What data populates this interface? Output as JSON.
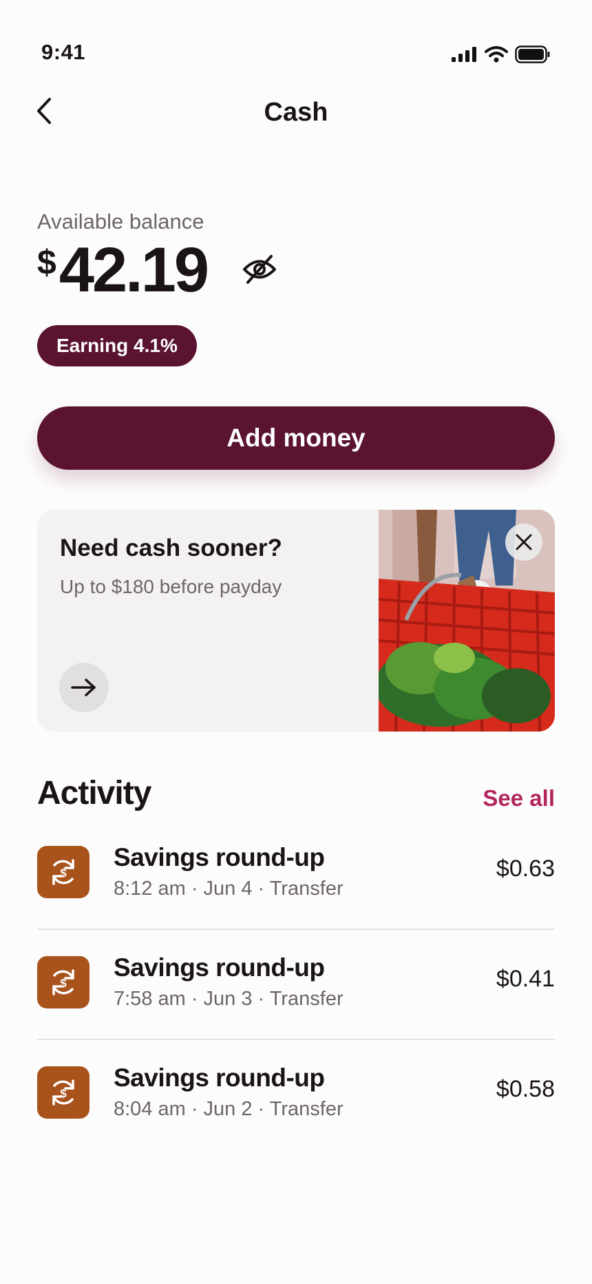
{
  "status": {
    "time": "9:41"
  },
  "nav": {
    "title": "Cash"
  },
  "balance": {
    "label": "Available balance",
    "currency": "$",
    "amount": "42.19"
  },
  "earning_badge": "Earning 4.1%",
  "add_money_label": "Add money",
  "promo": {
    "title": "Need cash sooner?",
    "subtitle": "Up to $180 before payday"
  },
  "activity": {
    "title": "Activity",
    "see_all": "See all",
    "items": [
      {
        "name": "Savings round-up",
        "meta": "8:12 am · Jun 4 · Transfer",
        "amount": "$0.63"
      },
      {
        "name": "Savings round-up",
        "meta": "7:58 am · Jun 3 · Transfer",
        "amount": "$0.41"
      },
      {
        "name": "Savings round-up",
        "meta": "8:04 am · Jun 2 · Transfer",
        "amount": "$0.58"
      }
    ]
  },
  "colors": {
    "brand": "#5a1330",
    "accent_link": "#b2255d",
    "txn_icon": "#a8521c"
  },
  "icons": [
    "back-chevron-icon",
    "eye-slash-icon",
    "arrow-right-icon",
    "close-icon",
    "round-up-dollar-icon",
    "cellular-signal-icon",
    "wifi-icon",
    "battery-icon"
  ]
}
